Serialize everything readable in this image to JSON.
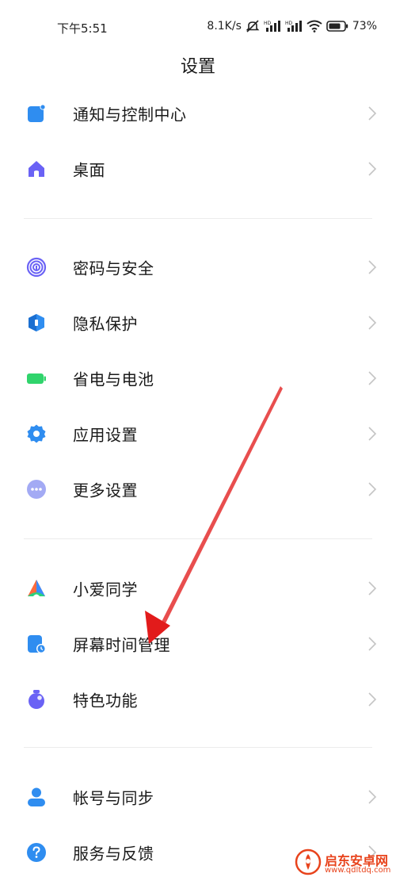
{
  "status_bar": {
    "time": "下午5:51",
    "net_speed": "8.1K/s",
    "battery": "73%",
    "hd1": "HD",
    "hd2": "HD"
  },
  "title": "设置",
  "groups": [
    [
      {
        "id": "notifications",
        "label": "通知与控制中心",
        "icon": "notification-icon",
        "color": "#2f8df0"
      },
      {
        "id": "home-screen",
        "label": "桌面",
        "icon": "home-icon",
        "color": "#6a62f5"
      }
    ],
    [
      {
        "id": "password-security",
        "label": "密码与安全",
        "icon": "fingerprint-icon",
        "color": "#6a62f5"
      },
      {
        "id": "privacy",
        "label": "隐私保护",
        "icon": "privacy-shield-icon",
        "color": "#2f8df0"
      },
      {
        "id": "battery",
        "label": "省电与电池",
        "icon": "battery-icon",
        "color": "#30d46c"
      },
      {
        "id": "app-settings",
        "label": "应用设置",
        "icon": "gear-icon",
        "color": "#2f8df0"
      },
      {
        "id": "more-settings",
        "label": "更多设置",
        "icon": "more-dots-icon",
        "color": "#7c86f0"
      }
    ],
    [
      {
        "id": "xiaoai",
        "label": "小爱同学",
        "icon": "xiaoai-icon",
        "color": "#ff6a3d"
      },
      {
        "id": "screen-time",
        "label": "屏幕时间管理",
        "icon": "screen-time-icon",
        "color": "#2f8df0"
      },
      {
        "id": "special-features",
        "label": "特色功能",
        "icon": "features-icon",
        "color": "#6a62f5"
      }
    ],
    [
      {
        "id": "account-sync",
        "label": "帐号与同步",
        "icon": "account-icon",
        "color": "#2f8df0"
      },
      {
        "id": "service-feedback",
        "label": "服务与反馈",
        "icon": "help-icon",
        "color": "#2f8df0"
      }
    ]
  ],
  "watermark": {
    "name": "启东安卓网",
    "url": "www.qdltdq.com"
  },
  "colors": {
    "accent_blue": "#2f8df0",
    "accent_purple": "#6a62f5",
    "accent_green": "#30d46c",
    "arrow_red": "#e21b1b",
    "divider": "#ececec",
    "chevron": "#c4c4c4"
  }
}
